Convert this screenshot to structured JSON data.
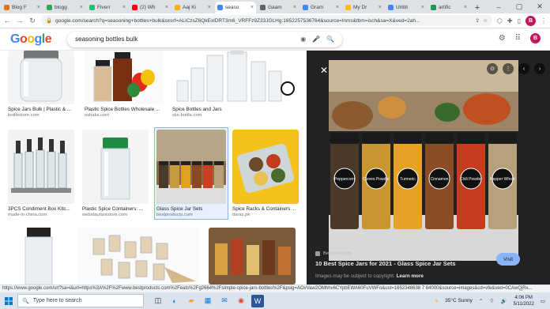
{
  "browser": {
    "tabs": [
      {
        "label": "Blog F",
        "color": "#e8710a",
        "active": false
      },
      {
        "label": "blogg",
        "color": "#34a853",
        "active": false
      },
      {
        "label": "Fiverr",
        "color": "#1dbf73",
        "active": false
      },
      {
        "label": "(2) Wh",
        "color": "#ff0000",
        "active": false
      },
      {
        "label": "Aaj Ki",
        "color": "#f4b400",
        "active": false
      },
      {
        "label": "seaso",
        "color": "#4285f4",
        "active": true
      },
      {
        "label": "Gaam",
        "color": "#5f6368",
        "active": false
      },
      {
        "label": "Gram",
        "color": "#4285f4",
        "active": false
      },
      {
        "label": "My Dr",
        "color": "#fbbc05",
        "active": false
      },
      {
        "label": "Untitl",
        "color": "#4285f4",
        "active": false
      },
      {
        "label": "artific",
        "color": "#0f9d58",
        "active": false
      }
    ],
    "new_tab": "+",
    "url": "google.com/search?q=seasoning+bottles+bulk&sxsrf=ALiCzsZ6QkExlDRT3m6_VRFFz9Z33JGLHg:1652257536764&source=lnms&tbm=isch&sa=X&ved=2ah...",
    "profile_initial": "B"
  },
  "google": {
    "logo": [
      "G",
      "o",
      "o",
      "g",
      "l",
      "e"
    ],
    "query": "seasoning bottles bulk",
    "profile_initial": "B"
  },
  "results": [
    {
      "title": "Spice Jars Bulk | Plastic & ...",
      "source": "bottlestore.com"
    },
    {
      "title": "Plastic Spice Bottles Wholesale ...",
      "source": "oshaks.com"
    },
    {
      "title": "Spice Bottles and Jars",
      "source": "sks-bottle.com"
    },
    {
      "title": "3PCS Condiment Box Kitc...",
      "source": "made-in-china.com"
    },
    {
      "title": "Plastic Spice Containers: ...",
      "source": "webstaurantstore.com"
    },
    {
      "title": "Glass Spice Jar Sets",
      "source": "bestproducts.com"
    },
    {
      "title": "Spice Racks & Containers ...",
      "source": "daraz.pk"
    }
  ],
  "preview": {
    "source": "Best Products",
    "title": "10 Best Spice Jars for 2021 - Glass Spice Jar Sets",
    "note": "Images may be subject to copyright.",
    "learn_more": "Learn more",
    "visit": "Visit",
    "jar_labels": [
      "Peppercorn",
      "Cloves Powder",
      "Turmeric",
      "Cinnamon",
      "Chili Powder",
      "Pepper Whole"
    ]
  },
  "status_url": "https://www.google.com/url?sa=i&url=https%3A%2F%2Fwww.bestproducts.com%2Feats%2Fg2664%2Fsimple-spice-jars-bottles%2F&psig=AOvVaw2OMhhv6CYpbEWA60FuVWFo&ust=1652348638 7 84000&source=images&cd=vfe&ved=0CAwQjRx...",
  "taskbar": {
    "search_placeholder": "Type here to search",
    "weather": "35°C  Sunny",
    "time": "4:06 PM",
    "date": "5/11/2022"
  }
}
